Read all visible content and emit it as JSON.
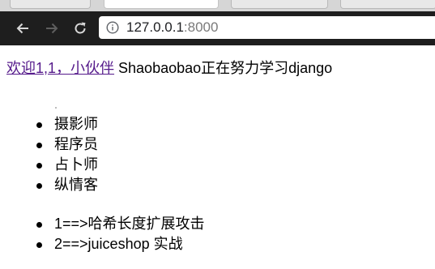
{
  "browser": {
    "address_host": "127.0.0.1",
    "address_port": ":8000"
  },
  "page": {
    "welcome_link": "欢迎1,1，小伙伴",
    "welcome_text": " Shaobaobao正在努力学习django",
    "roles": [
      "摄影师",
      "程序员",
      "占卜师",
      "纵情客"
    ],
    "posts": [
      "1==>哈希长度扩展攻击",
      "2==>juiceshop 实战"
    ]
  }
}
